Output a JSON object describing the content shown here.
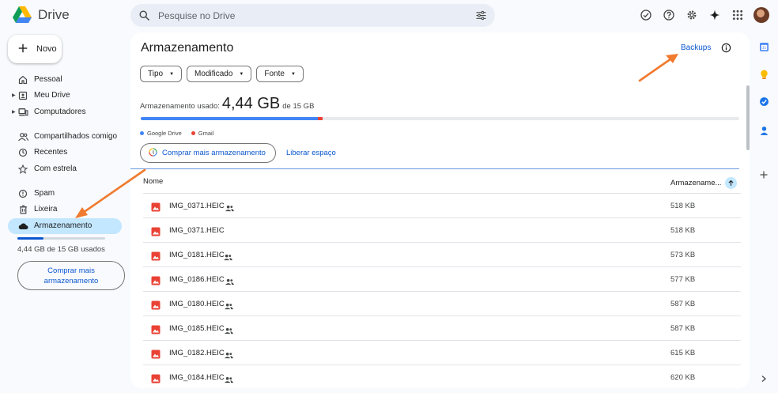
{
  "app": {
    "name": "Drive"
  },
  "search": {
    "placeholder": "Pesquise no Drive"
  },
  "sidebar": {
    "new_label": "Novo",
    "items": [
      {
        "label": "Pessoal",
        "icon": "home-icon"
      },
      {
        "label": "Meu Drive",
        "icon": "my-drive-icon"
      },
      {
        "label": "Computadores",
        "icon": "computer-icon"
      },
      {
        "label": "Compartilhados comigo",
        "icon": "people-icon"
      },
      {
        "label": "Recentes",
        "icon": "clock-icon"
      },
      {
        "label": "Com estrela",
        "icon": "star-icon"
      },
      {
        "label": "Spam",
        "icon": "spam-icon"
      },
      {
        "label": "Lixeira",
        "icon": "trash-icon"
      },
      {
        "label": "Armazenamento",
        "icon": "cloud-icon"
      }
    ],
    "storage_used_fraction": 0.296,
    "storage_text": "4,44 GB de 15 GB usados",
    "buy_label": "Comprar mais armazenamento"
  },
  "main": {
    "title": "Armazenamento",
    "backups_label": "Backups",
    "filters": [
      "Tipo",
      "Modificado",
      "Fonte"
    ],
    "usage_label": "Armazenamento usado:",
    "usage_value": "4,44 GB",
    "usage_total": "de 15 GB",
    "usage_breakdown": [
      {
        "name": "Google Drive",
        "fraction": 0.296,
        "color": "#4285f4"
      },
      {
        "name": "Gmail",
        "fraction": 0.008,
        "color": "#ea4335"
      }
    ],
    "buy_label": "Comprar mais armazenamento",
    "free_label": "Liberar espaço",
    "columns": {
      "name": "Nome",
      "storage": "Armazename..."
    },
    "files": [
      {
        "name": "IMG_0371.HEIC",
        "shared": true,
        "size": "518 KB"
      },
      {
        "name": "IMG_0371.HEIC",
        "shared": false,
        "size": "518 KB"
      },
      {
        "name": "IMG_0181.HEIC",
        "shared": true,
        "size": "573 KB"
      },
      {
        "name": "IMG_0186.HEIC",
        "shared": true,
        "size": "577 KB"
      },
      {
        "name": "IMG_0180.HEIC",
        "shared": true,
        "size": "587 KB"
      },
      {
        "name": "IMG_0185.HEIC",
        "shared": true,
        "size": "587 KB"
      },
      {
        "name": "IMG_0182.HEIC",
        "shared": true,
        "size": "615 KB"
      },
      {
        "name": "IMG_0184.HEIC",
        "shared": true,
        "size": "620 KB"
      }
    ]
  },
  "colors": {
    "accent": "#0b57d0",
    "active_bg": "#c2e7ff",
    "annotation_arrow": "#f07a2e"
  }
}
